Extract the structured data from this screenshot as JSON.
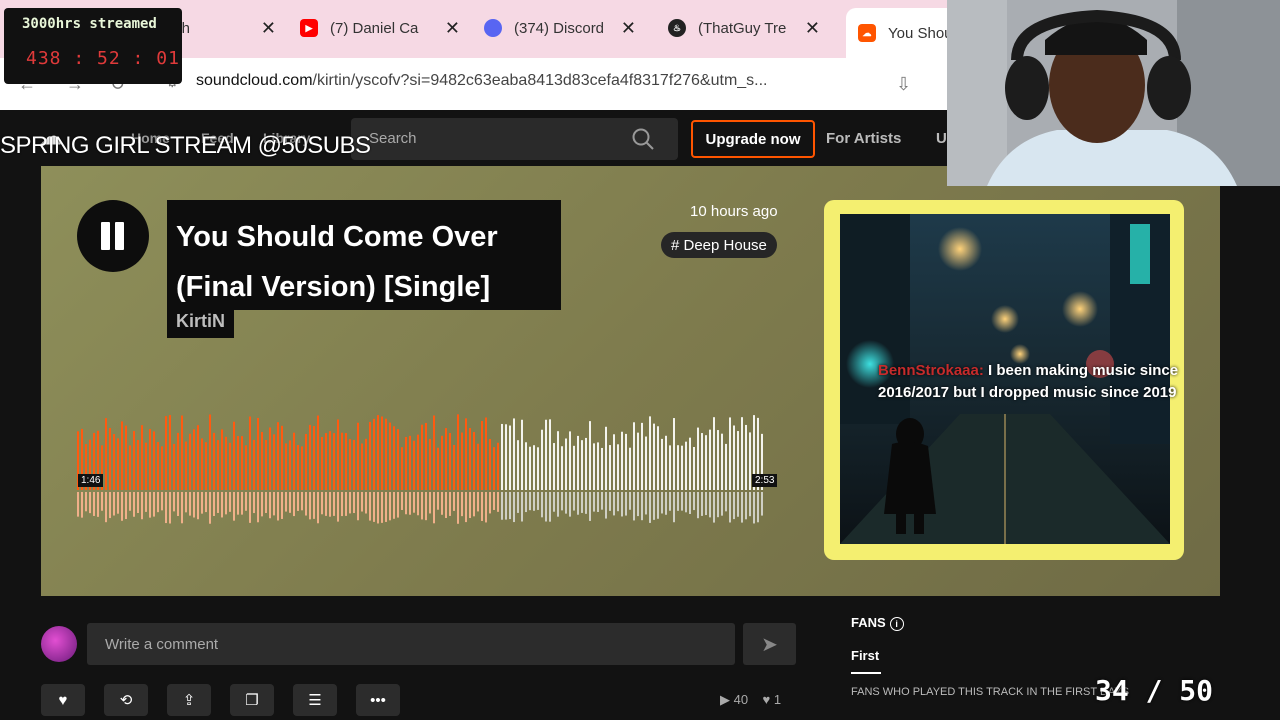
{
  "browser": {
    "tabs": [
      {
        "label": "tch",
        "favicon": "twitch"
      },
      {
        "label": "(7) Daniel Ca",
        "favicon": "youtube"
      },
      {
        "label": "(374) Discord",
        "favicon": "discord",
        "badge": "374"
      },
      {
        "label": "(ThatGuy Tre",
        "favicon": "flame"
      },
      {
        "label": "You Shou",
        "favicon": "soundcloud"
      }
    ],
    "url_host": "soundcloud.com",
    "url_path": "/kirtin/yscofv?si=9482c63eaba8413d83cefa4f8317f276&utm_s..."
  },
  "stream_counter": {
    "label": "3000hrs streamed",
    "hours": "438",
    "minutes": "52",
    "seconds": "01"
  },
  "overlay_title": "SPRING GIRL STREAM @50SUBS",
  "soundcloud_nav": {
    "home": "Home",
    "feed": "Feed",
    "library": "Library",
    "search_placeholder": "Search",
    "upgrade": "Upgrade now",
    "for_artists": "For Artists",
    "upload": "U"
  },
  "track": {
    "title_line1": "You Should Come Over",
    "title_line2": "(Final Version) [Single]",
    "artist": "KirtiN",
    "posted": "10 hours ago",
    "tag": "# Deep House",
    "current_time": "1:46",
    "duration": "2:53",
    "progress": 0.613
  },
  "chat": {
    "user": "BennStrokaaa:",
    "line1": "I been making music since",
    "line2": "2016/2017 but I dropped music since 2019"
  },
  "comments": {
    "placeholder": "Write a comment"
  },
  "fans": {
    "heading": "FANS",
    "tab_first": "First",
    "description": "FANS WHO PLAYED THIS TRACK IN THE FIRST DAYS"
  },
  "subgoal": "34 / 50",
  "stats": {
    "plays": "40",
    "likes": "1"
  },
  "colors": {
    "accent": "#ff5500",
    "artwork_frame": "#f4ef70"
  }
}
